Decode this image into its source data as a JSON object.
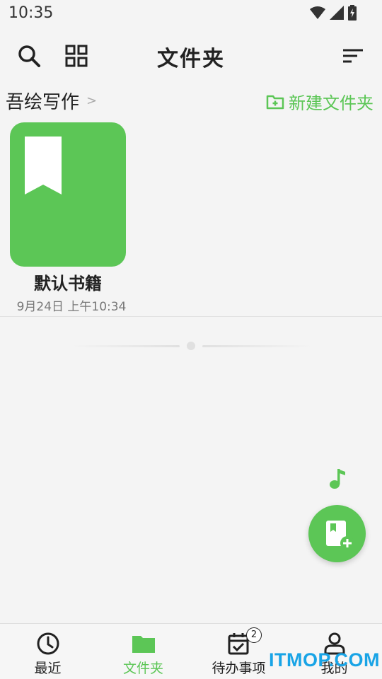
{
  "status_bar": {
    "time": "10:35"
  },
  "app_bar": {
    "title": "文件夹"
  },
  "breadcrumb": {
    "title": "吾绘写作",
    "chevron": ">",
    "new_folder_label": "新建文件夹"
  },
  "books": [
    {
      "name": "默认书籍",
      "date": "9月24日 上午10:34"
    }
  ],
  "bottom_nav": {
    "items": [
      {
        "label": "最近",
        "icon": "clock-icon",
        "active": false
      },
      {
        "label": "文件夹",
        "icon": "folder-icon",
        "active": true
      },
      {
        "label": "待办事项",
        "icon": "calendar-check-icon",
        "active": false,
        "badge": "2"
      },
      {
        "label": "我的",
        "icon": "person-icon",
        "active": false
      }
    ]
  },
  "watermark": "ITMOP.COM",
  "colors": {
    "accent": "#5cc656",
    "background": "#f4f4f4",
    "watermark": "#19a4e6"
  }
}
